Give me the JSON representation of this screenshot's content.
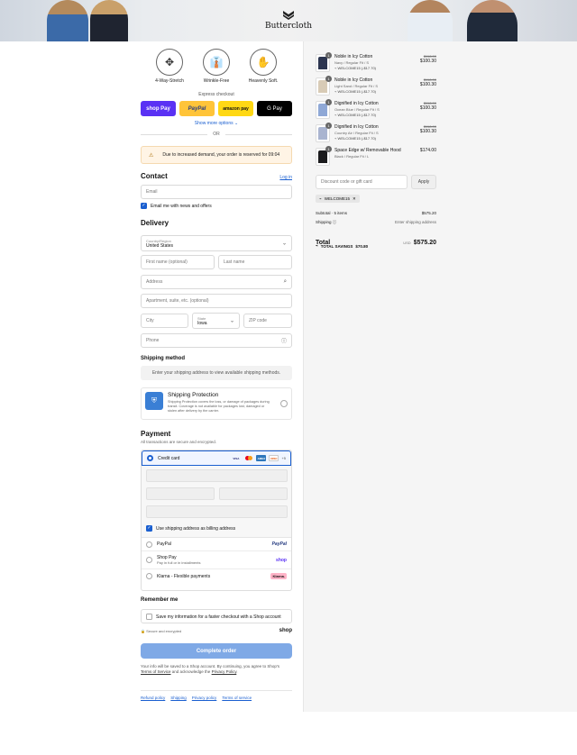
{
  "header": {
    "brand": "Buttercloth"
  },
  "badges": [
    {
      "icon": "stretch-icon",
      "label": "4-Way-Stretch"
    },
    {
      "icon": "shirt-icon",
      "label": "Wrinkle-Free"
    },
    {
      "icon": "hand-icon",
      "label": "Heavenly Soft."
    }
  ],
  "express": {
    "label": "Express checkout",
    "shop": "shop Pay",
    "paypal": "PayPal",
    "amazon": "amazon pay",
    "gpay": "G Pay",
    "more": "Show more options ⌄",
    "or": "OR"
  },
  "alert": {
    "text": "Due to increased demand, your order is reserved for 09:04"
  },
  "contact": {
    "title": "Contact",
    "login": "Log in",
    "email_placeholder": "Email",
    "news": "Email me with news and offers"
  },
  "delivery": {
    "title": "Delivery",
    "country_label": "Country/Region",
    "country": "United States",
    "first": "First name (optional)",
    "last": "Last name",
    "address": "Address",
    "apt": "Apartment, suite, etc. (optional)",
    "city": "City",
    "state_label": "State",
    "state": "Iowa",
    "zip": "ZIP code",
    "phone": "Phone"
  },
  "shipping": {
    "title": "Shipping method",
    "empty": "Enter your shipping address to view available shipping methods.",
    "protect_title": "Shipping Protection",
    "protect_desc": "Shipping Protection covers the loss, or damage of packages during transit. Coverage is not available for packages lost, damaged or stolen after delivery by the carrier."
  },
  "payment": {
    "title": "Payment",
    "subtitle": "All transactions are secure and encrypted.",
    "cc": "Credit card",
    "more_cards": "+5",
    "billing": "Use shipping address as billing address",
    "paypal": "PayPal",
    "shoppay": "Shop Pay",
    "shoppay_sub": "Pay in full or in installments",
    "klarna": "Klarna - Flexible payments",
    "klarna_logo": "Klarna."
  },
  "remember": {
    "title": "Remember me",
    "save": "Save my information for a faster checkout with a Shop account",
    "secure": "Secure and encrypted",
    "shop": "shop"
  },
  "cta": {
    "complete": "Complete order"
  },
  "legal": {
    "pre": "Your info will be saved to a Shop account. By continuing, you agree to Shop's",
    "tos": "Terms of Service",
    "mid": "and acknowledge the",
    "privacy": "Privacy Policy"
  },
  "footer": [
    "Refund policy",
    "Shipping",
    "Privacy policy",
    "Terms of service"
  ],
  "cart": {
    "items": [
      {
        "name": "Noble in Icy Cotton",
        "variant": "Navy / Regular Fit / S",
        "discount": "WELCOME15 (-$17.70)",
        "old": "$118.00",
        "price": "$100.30",
        "qty": "1",
        "color": "#2c3550"
      },
      {
        "name": "Noble in Icy Cotton",
        "variant": "Light Sand / Regular Fit / S",
        "discount": "WELCOME15 (-$17.70)",
        "old": "$118.00",
        "price": "$100.30",
        "qty": "1",
        "color": "#d8cbb6"
      },
      {
        "name": "Dignified in Icy Cotton",
        "variant": "Ocean Blue / Regular Fit / S",
        "discount": "WELCOME15 (-$17.70)",
        "old": "$118.00",
        "price": "$100.30",
        "qty": "1",
        "color": "#8fa8d6"
      },
      {
        "name": "Dignified in Icy Cotton",
        "variant": "Country Air / Regular Fit / S",
        "discount": "WELCOME15 (-$17.70)",
        "old": "$118.00",
        "price": "$100.30",
        "qty": "1",
        "color": "#a9b4d0"
      },
      {
        "name": "Space Edge w/ Removable Hood",
        "variant": "Black / Regular Fit / L",
        "discount": "",
        "old": "",
        "price": "$174.00",
        "qty": "1",
        "color": "#1b1b1d"
      }
    ],
    "discount_placeholder": "Discount code or gift card",
    "apply": "Apply",
    "code": "WELCOME15",
    "subtotal_label": "Subtotal · 5 items",
    "subtotal": "$575.20",
    "shipping_label": "Shipping",
    "shipping": "Enter shipping address",
    "total_label": "Total",
    "currency": "USD",
    "total": "$575.20",
    "savings_label": "TOTAL SAVINGS",
    "savings": "$70.80"
  }
}
